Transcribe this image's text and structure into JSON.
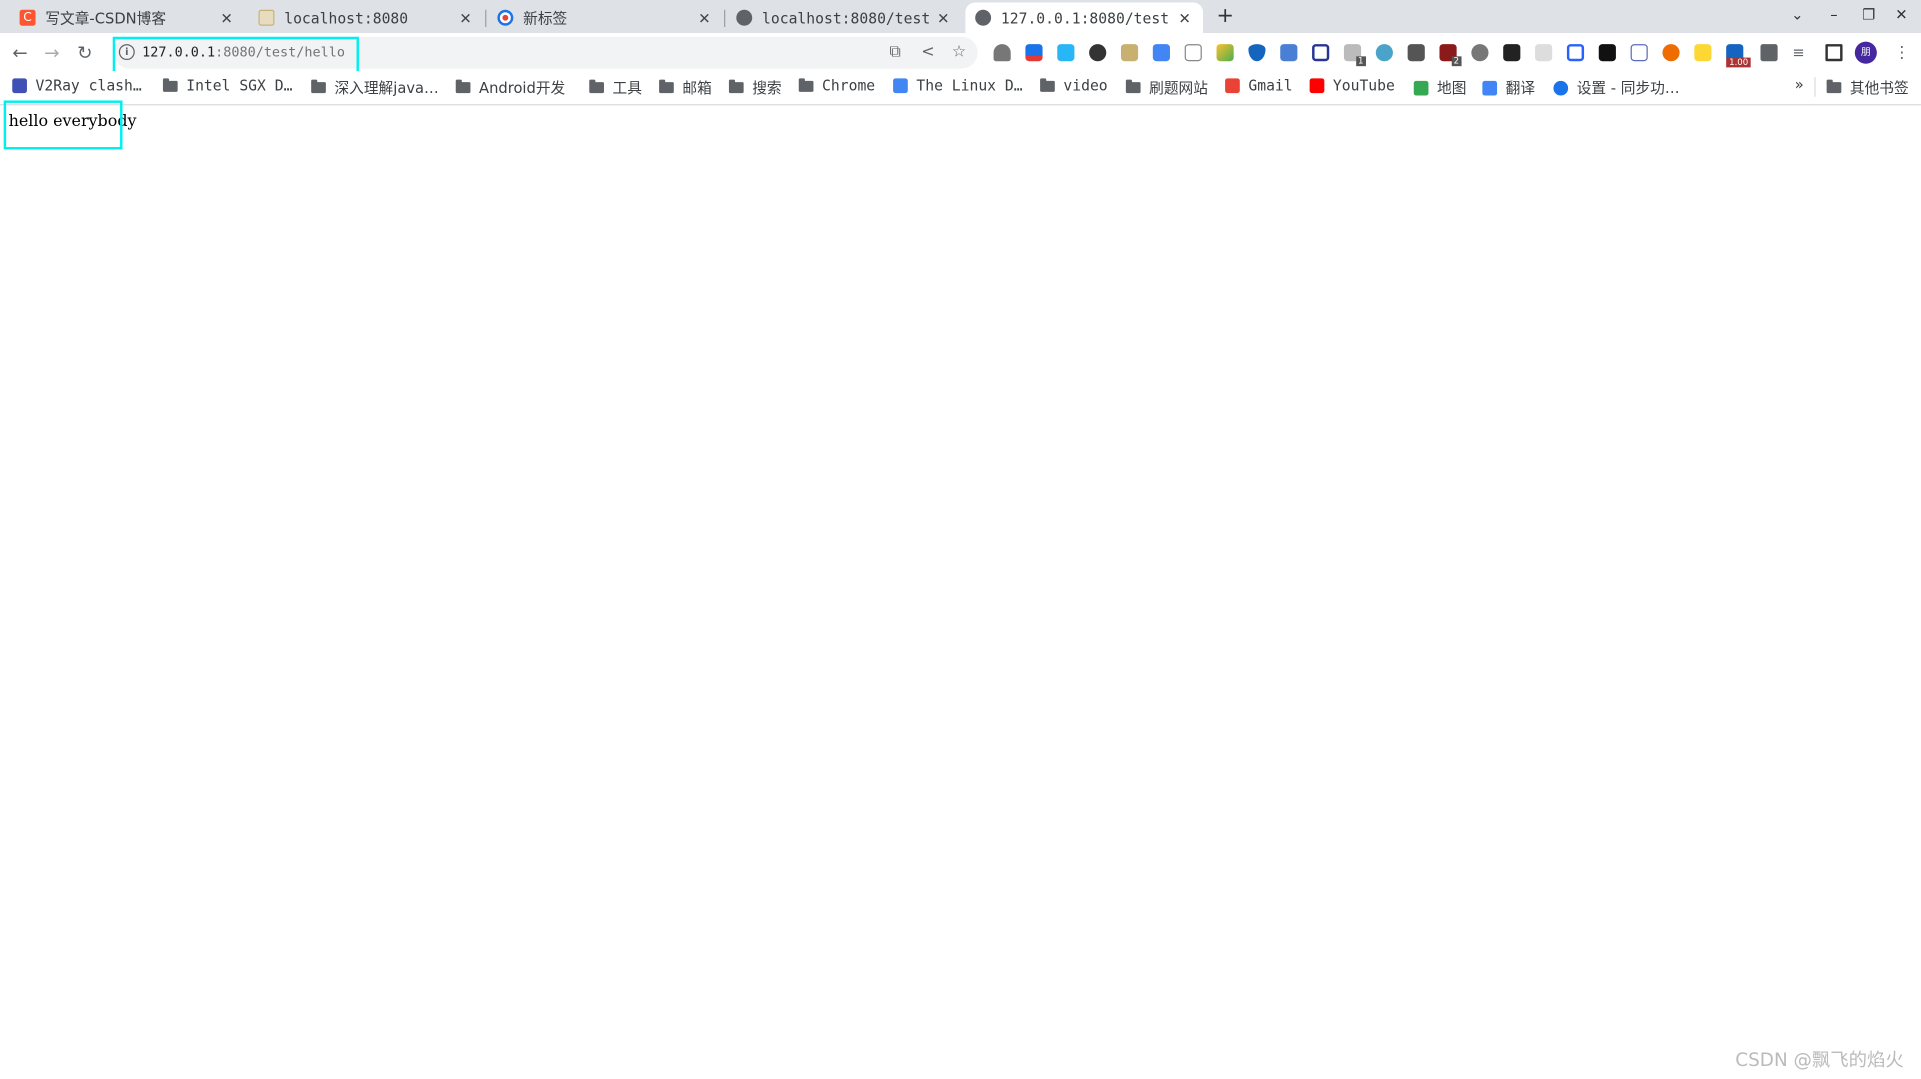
{
  "tabs": [
    {
      "label": "写文章-CSDN博客",
      "favicon": "csdn-icon",
      "color": "#fc5531"
    },
    {
      "label": "localhost:8080",
      "favicon": "image-icon",
      "color": "#c9b27a"
    },
    {
      "label": "新标签",
      "favicon": "target-icon",
      "color": "#1a73e8"
    },
    {
      "label": "localhost:8080/test",
      "favicon": "globe-icon",
      "color": "#5f6368"
    },
    {
      "label": "127.0.0.1:8080/test",
      "favicon": "globe-icon",
      "color": "#5f6368",
      "active": true
    }
  ],
  "address_bar": {
    "host": "127.0.0.1",
    "rest": ":8080/test/hello"
  },
  "bookmarks": [
    {
      "label": "V2Ray clash…",
      "icon": "v2ray-icon"
    },
    {
      "label": "Intel SGX D…",
      "icon": "folder-icon"
    },
    {
      "label": "深入理解java…",
      "icon": "folder-icon"
    },
    {
      "label": "Android开发",
      "icon": "folder-icon"
    },
    {
      "label": "工具",
      "icon": "folder-icon"
    },
    {
      "label": "邮箱",
      "icon": "folder-icon"
    },
    {
      "label": "搜索",
      "icon": "folder-icon"
    },
    {
      "label": "Chrome",
      "icon": "folder-icon"
    },
    {
      "label": "The Linux D…",
      "icon": "document-icon"
    },
    {
      "label": "video",
      "icon": "folder-icon"
    },
    {
      "label": "刷题网站",
      "icon": "folder-icon"
    },
    {
      "label": "Gmail",
      "icon": "gmail-icon"
    },
    {
      "label": "YouTube",
      "icon": "youtube-icon"
    },
    {
      "label": "地图",
      "icon": "maps-icon"
    },
    {
      "label": "翻译",
      "icon": "translate-icon"
    },
    {
      "label": "设置 - 同步功…",
      "icon": "gear-icon"
    }
  ],
  "other_bookmarks": "其他书签",
  "more_bookmarks": "»",
  "extension_badges": {
    "mail": "1",
    "ublock": "2",
    "speed": "1.00"
  },
  "profile_initial": "朋",
  "page": {
    "text": "hello everybody"
  },
  "watermark": "CSDN @飘飞的焰火",
  "highlight_color": "#00f0f0"
}
